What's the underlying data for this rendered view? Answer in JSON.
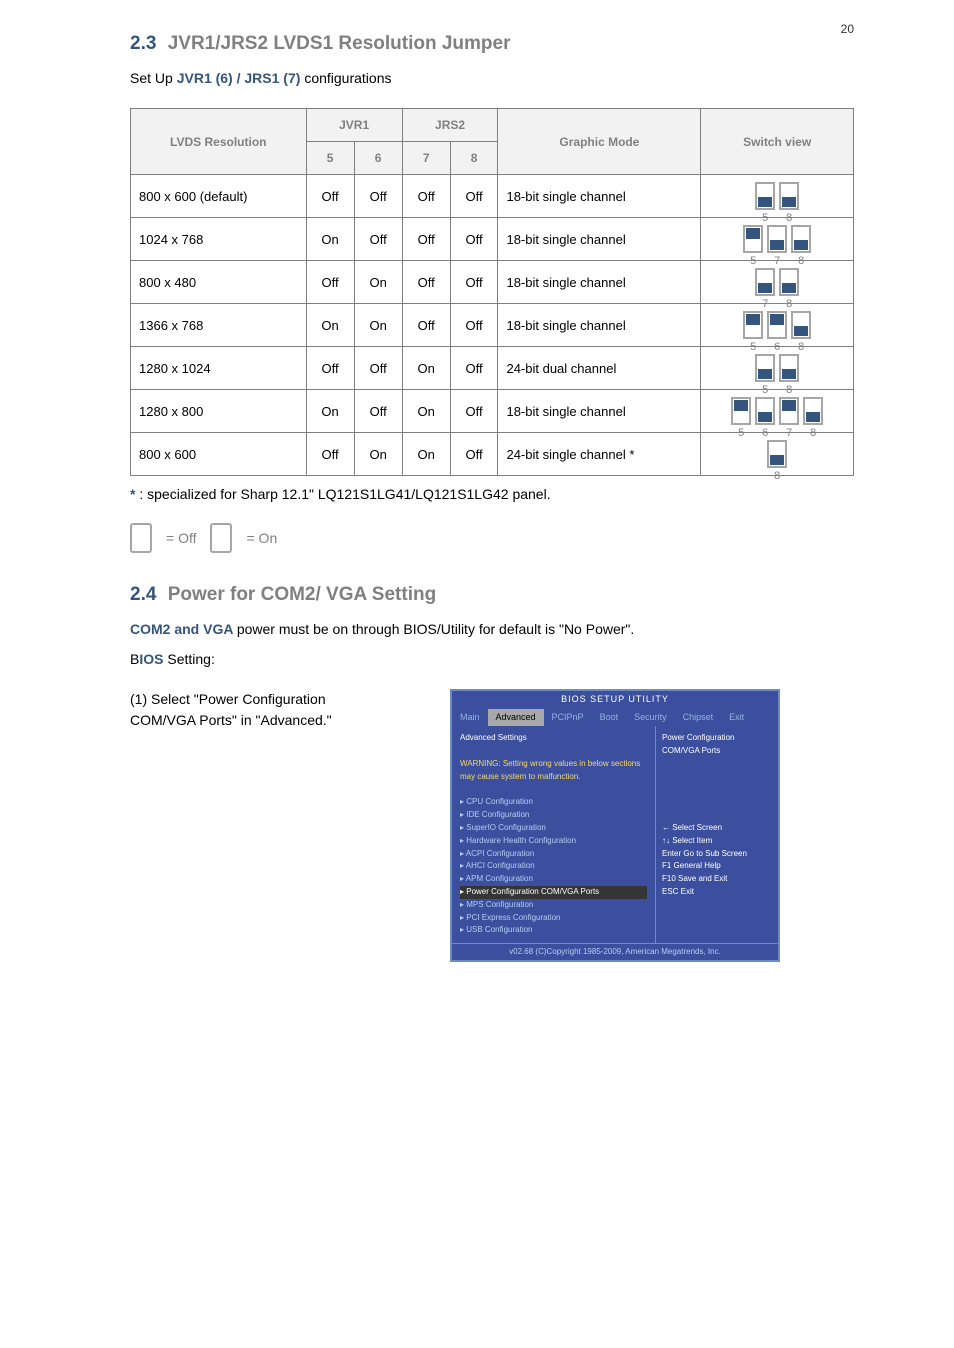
{
  "page_number": "20",
  "section1": {
    "number": "2.3",
    "title": "JVR1/JRS2 LVDS1 Resolution Jumper",
    "desc_prefix": "Set Up ",
    "desc_hl": "JVR1 (6) / JRS1 (7)",
    "desc_suffix": " configurations",
    "table": {
      "headers": [
        "LVDS Resolution",
        "JVR1",
        "JRS2",
        "Graphic Mode",
        "Switch view"
      ],
      "subheaders_jvr": [
        "5",
        "6",
        "7",
        "8"
      ],
      "rows": [
        {
          "res": "800 x 600 (default)",
          "j": [
            "Off",
            "Off",
            "Off",
            "Off"
          ],
          "mode": "18-bit single channel",
          "sw": [
            {
              "n": "5",
              "s": "off"
            },
            {
              "n": "8",
              "s": "off"
            }
          ]
        },
        {
          "res": "1024 x 768",
          "j": [
            "On",
            "Off",
            "Off",
            "Off"
          ],
          "mode": "18-bit single channel",
          "sw": [
            {
              "n": "5",
              "s": "on"
            },
            {
              "n": "7",
              "s": "off"
            },
            {
              "n": "8",
              "s": "off"
            }
          ]
        },
        {
          "res": "800 x 480",
          "j": [
            "Off",
            "On",
            "Off",
            "Off"
          ],
          "mode": "18-bit single channel",
          "sw": [
            {
              "n": "7",
              "s": "off"
            },
            {
              "n": "8",
              "s": "off"
            }
          ]
        },
        {
          "res": "1366 x 768",
          "j": [
            "On",
            "On",
            "Off",
            "Off"
          ],
          "mode": "18-bit single channel",
          "sw": [
            {
              "n": "5",
              "s": "on"
            },
            {
              "n": "6",
              "s": "on"
            },
            {
              "n": "8",
              "s": "off"
            }
          ]
        },
        {
          "res": "1280 x 1024",
          "j": [
            "Off",
            "Off",
            "On",
            "Off"
          ],
          "mode": "24-bit dual channel",
          "sw": [
            {
              "n": "5",
              "s": "off"
            },
            {
              "n": "8",
              "s": "off"
            }
          ]
        },
        {
          "res": "1280 x 800",
          "j": [
            "On",
            "Off",
            "On",
            "Off"
          ],
          "mode": "18-bit single channel",
          "sw": [
            {
              "n": "5",
              "s": "on"
            },
            {
              "n": "6",
              "s": "off"
            },
            {
              "n": "7",
              "s": "on"
            },
            {
              "n": "8",
              "s": "off"
            }
          ]
        },
        {
          "res": "800 x 600",
          "j": [
            "Off",
            "On",
            "On",
            "Off"
          ],
          "mode": "24-bit single channel *",
          "sw": [
            {
              "n": "8",
              "s": "off"
            }
          ]
        }
      ]
    },
    "note_star_prefix": "* ",
    "note_star": ": specialized for Sharp 12.1\" LQ121S1LG41/LQ121S1LG42 panel.",
    "hands_on": "= On",
    "hands_off": "= Off"
  },
  "section2": {
    "number": "2.4",
    "title": "Power for COM2/ VGA Setting",
    "p1_prefix": "COM2 and VGA ",
    "p1_suffix": " power must be on through BIOS/Utility for default is \"No Power\".",
    "p2_prefix": "B",
    "p2_bold": "IOS",
    "p2_suffix": " Setting:",
    "step1": "(1) Select \"Power Configuration COM/VGA Ports\" in \"Advanced.\""
  },
  "bios": {
    "title": "BIOS SETUP UTILITY",
    "menu": [
      "Main",
      "Advanced",
      "PCIPnP",
      "Boot",
      "Security",
      "Chipset",
      "Exit"
    ],
    "heading": "Advanced Settings",
    "warn1": "WARNING: Setting wrong values in below sections",
    "warn2": "may cause system to malfunction.",
    "items": [
      "▸ CPU Configuration",
      "▸ IDE Configuration",
      "▸ SuperIO Configuration",
      "▸ Hardware Health Configuration",
      "▸ ACPI Configuration",
      "▸ AHCI Configuration",
      "▸ APM Configuration",
      "▸ Power Configuration COM/VGA Ports",
      "▸ MPS Configuration",
      "▸ PCI Express Configuration",
      "▸ USB Configuration"
    ],
    "right_title1": "Power Configuration",
    "right_title2": "COM/VGA Ports",
    "help": [
      "←    Select Screen",
      "↑↓   Select Item",
      "Enter Go to Sub Screen",
      "F1    General Help",
      "F10   Save and Exit",
      "ESC   Exit"
    ],
    "foot": "v02.68 (C)Copyright 1985-2009, American Megatrends, Inc."
  }
}
